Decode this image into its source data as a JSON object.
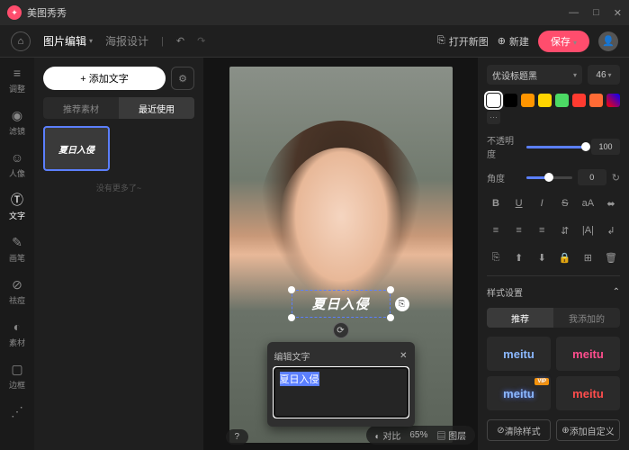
{
  "app": {
    "title": "美图秀秀"
  },
  "win": {
    "min": "—",
    "max": "□",
    "close": "✕"
  },
  "top": {
    "tab1": "图片编辑",
    "tab2": "海报设计",
    "open": "打开新图",
    "new": "新建",
    "save": "保存"
  },
  "side": {
    "adjust": "调整",
    "filter": "滤镜",
    "portrait": "人像",
    "text": "文字",
    "brush": "画笔",
    "blemish": "祛痘",
    "material": "素材",
    "frame": "边框"
  },
  "panel": {
    "add": "+ 添加文字",
    "sub1": "推荐素材",
    "sub2": "最近使用",
    "thumb": "夏日入侵",
    "nomore": "没有更多了~"
  },
  "textbox": {
    "content": "夏日入侵"
  },
  "pop": {
    "title": "编辑文字",
    "value": "夏日入侵"
  },
  "bottom": {
    "compare": "对比",
    "zoom": "65%",
    "layer": "图层"
  },
  "props": {
    "font": "优设标题黑",
    "size": "46",
    "opacity_label": "不透明度",
    "opacity": "100",
    "angle_label": "角度",
    "angle": "0",
    "section": "样式设置",
    "st1": "推荐",
    "st2": "我添加的",
    "m": "meitu",
    "clear": "清除样式",
    "addcustom": "添加自定义"
  },
  "colors": [
    "#ffffff",
    "#000000",
    "#ff9500",
    "#ffd500",
    "#4cd964",
    "#ff3b30",
    "#ff6b35"
  ]
}
